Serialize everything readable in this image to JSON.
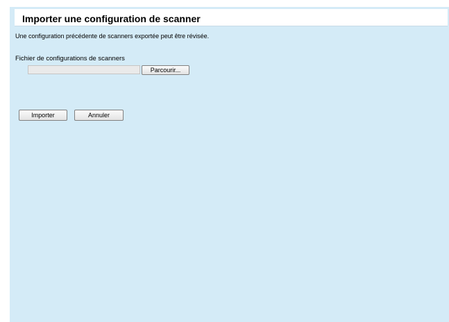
{
  "page": {
    "title": "Importer une configuration de scanner",
    "description": "Une configuration précédente de scanners exportée peut être révisée."
  },
  "file_field": {
    "label": "Fichier de configurations de scanners",
    "value": "",
    "browse_label": "Parcourir..."
  },
  "actions": {
    "import_label": "Importer",
    "cancel_label": "Annuler"
  },
  "colors": {
    "background": "#d4ebf7",
    "title_bar": "#ffffff"
  }
}
